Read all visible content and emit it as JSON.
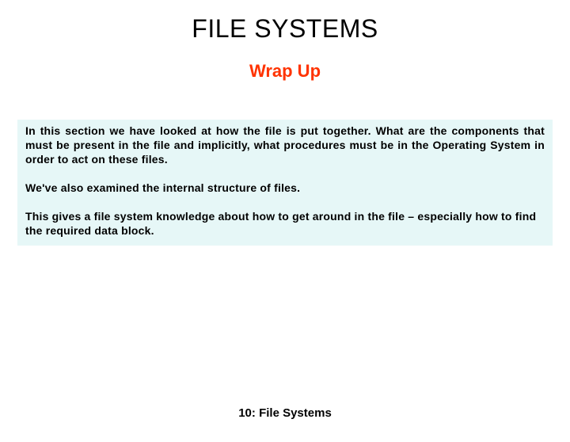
{
  "title": "FILE SYSTEMS",
  "subtitle": "Wrap Up",
  "paragraphs": {
    "p1": "In this section we have looked at how the file is put together.   What are the components that must be present in the file and implicitly, what procedures must be in the Operating System in order to act on these files.",
    "p2": "We've also examined the internal structure of files.",
    "p3": "This gives a file system knowledge about how to get around in the file – especially how to find the required data block."
  },
  "footer": "10: File Systems"
}
